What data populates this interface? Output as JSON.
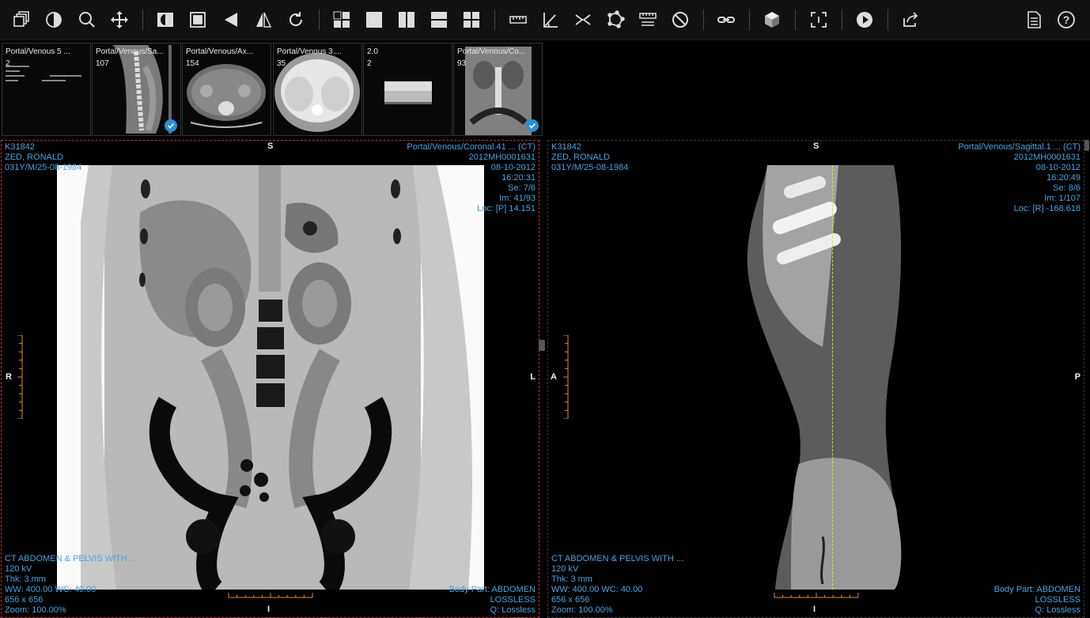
{
  "toolbar": {
    "icons": [
      "series-icon",
      "contrast-icon",
      "zoom-icon",
      "pan-icon",
      "invert-icon",
      "fit-icon",
      "flip-horizontal-icon",
      "flip-vertical-icon",
      "rotate-icon",
      "layout-grid-icon",
      "layout-1x1-icon",
      "layout-1x2-icon",
      "layout-2x1-icon",
      "layout-2x2-icon",
      "ruler-icon",
      "angle-icon",
      "cobb-angle-icon",
      "roi-icon",
      "calibrate-icon",
      "clear-icon",
      "link-icon",
      "3d-cube-icon",
      "crosshair-icon",
      "cine-play-icon",
      "share-icon",
      "report-icon",
      "help-icon"
    ]
  },
  "thumbnails": [
    {
      "title": "Portal/Venous 5 ...",
      "count": "2",
      "checked": false
    },
    {
      "title": "Portal/Venous/Sa...",
      "count": "107",
      "checked": true
    },
    {
      "title": "Portal/Venous/Ax...",
      "count": "154",
      "checked": false
    },
    {
      "title": "Portal/Venous 3....",
      "count": "35",
      "checked": false
    },
    {
      "title": "2.0",
      "count": "2",
      "checked": false
    },
    {
      "title": "Portal/Venous/Co...",
      "count": "93",
      "checked": true
    }
  ],
  "left_viewport": {
    "top_left": [
      "K31842",
      "ZED, RONALD",
      "031Y/M/25-08-1984"
    ],
    "top_right": [
      "Portal/Venous/Coronal.41 ... (CT)",
      "2012MH0001631",
      "08-10-2012",
      "16:20:31",
      "Se: 7/6",
      "Im: 41/93",
      "Loc: [P] 14.151"
    ],
    "bottom_left": [
      "CT ABDOMEN & PELVIS WITH ...",
      "120 kV",
      "Thk: 3 mm",
      "WW: 400.00 WC: 40.00",
      "656 x 656",
      "Zoom: 100.00%"
    ],
    "bottom_right": [
      "Body Part: ABDOMEN",
      "LOSSLESS",
      "Q: Lossless"
    ],
    "orient": {
      "top": "S",
      "bottom": "I",
      "left": "R",
      "right": "L"
    }
  },
  "right_viewport": {
    "top_left": [
      "K31842",
      "ZED, RONALD",
      "031Y/M/25-08-1984"
    ],
    "top_right": [
      "Portal/Venous/Sagittal.1 ... (CT)",
      "2012MH0001631",
      "08-10-2012",
      "16:20:49",
      "Se: 8/6",
      "Im: 1/107",
      "Loc: [R] -168.618"
    ],
    "bottom_left": [
      "CT ABDOMEN & PELVIS WITH ...",
      "120 kV",
      "Thk: 3 mm",
      "WW: 400.00 WC: 40.00",
      "656 x 656",
      "Zoom: 100.00%"
    ],
    "bottom_right": [
      "Body Part: ABDOMEN",
      "LOSSLESS",
      "Q: Lossless"
    ],
    "orient": {
      "top": "S",
      "bottom": "I",
      "left": "A",
      "right": "P"
    }
  },
  "colors": {
    "overlay_text": "#4aa3df",
    "active_border": "#c0342f",
    "scale_bar": "#e08a2a",
    "reference_line": "#e6e000",
    "check_badge": "#2a8fd6"
  }
}
